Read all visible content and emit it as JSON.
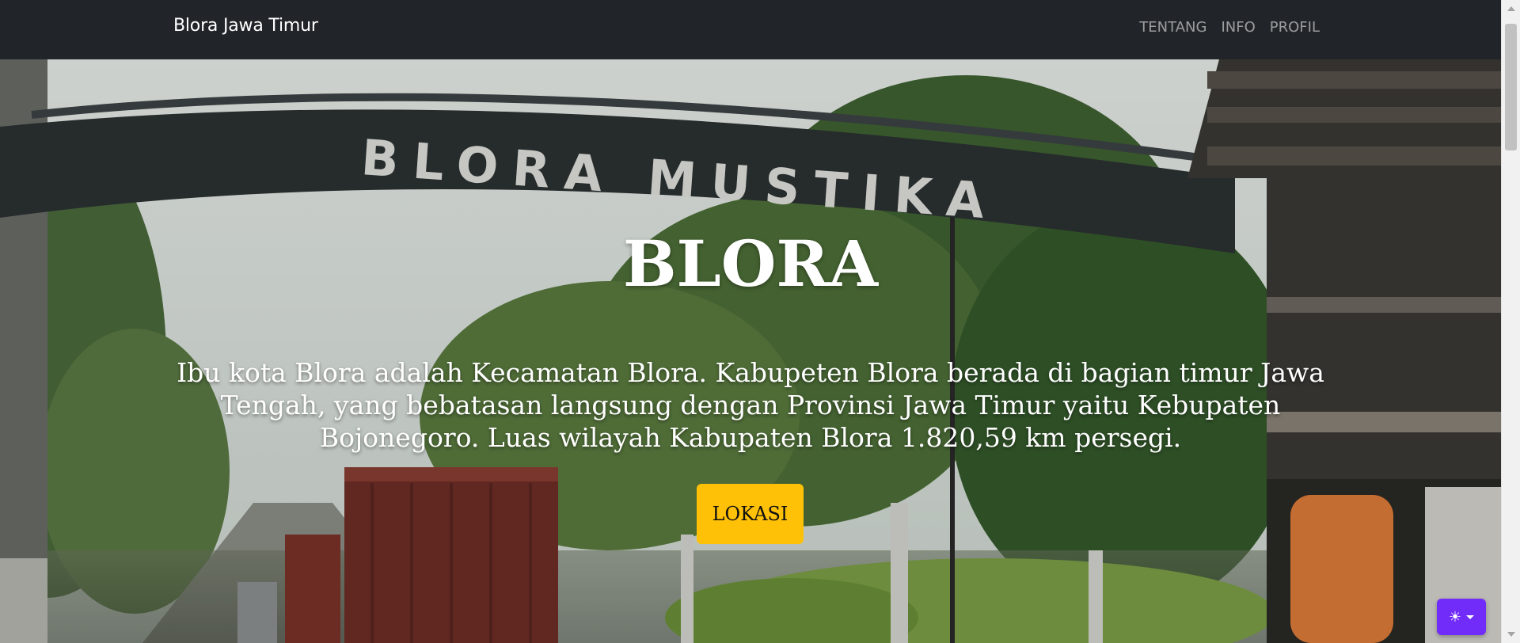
{
  "navbar": {
    "brand": "Blora Jawa Timur",
    "links": [
      "TENTANG",
      "INFO",
      "PROFIL"
    ]
  },
  "hero": {
    "sign_text": "BLORA MUSTIKA",
    "title": "BLORA",
    "description": "Ibu kota Blora adalah Kecamatan Blora. Kabupeten Blora berada di bagian timur Jawa Tengah, yang bebatasan langsung dengan Provinsi Jawa Timur yaitu Kebupaten Bojonegoro. Luas wilayah Kabupaten Blora 1.820,59 km persegi.",
    "button_label": "LOKASI"
  },
  "theme_toggle": {
    "icon": "sun-icon"
  },
  "colors": {
    "navbar_bg": "#212529",
    "button_bg": "#ffc107",
    "toggle_bg": "#712cf9"
  }
}
